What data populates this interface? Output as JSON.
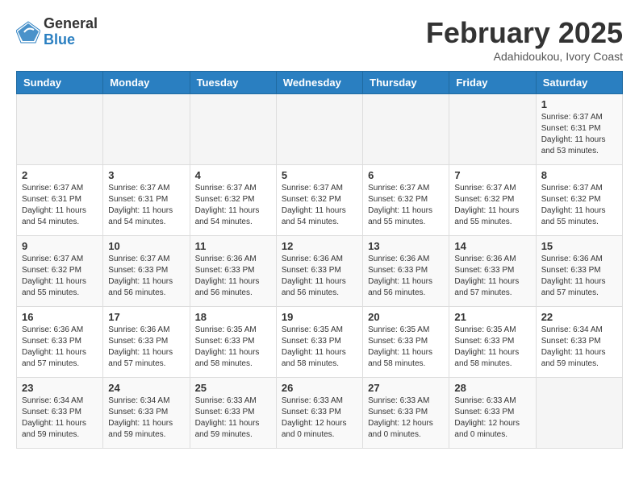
{
  "logo": {
    "general": "General",
    "blue": "Blue"
  },
  "header": {
    "month": "February 2025",
    "location": "Adahidoukou, Ivory Coast"
  },
  "days_of_week": [
    "Sunday",
    "Monday",
    "Tuesday",
    "Wednesday",
    "Thursday",
    "Friday",
    "Saturday"
  ],
  "weeks": [
    [
      {
        "day": "",
        "info": ""
      },
      {
        "day": "",
        "info": ""
      },
      {
        "day": "",
        "info": ""
      },
      {
        "day": "",
        "info": ""
      },
      {
        "day": "",
        "info": ""
      },
      {
        "day": "",
        "info": ""
      },
      {
        "day": "1",
        "info": "Sunrise: 6:37 AM\nSunset: 6:31 PM\nDaylight: 11 hours\nand 53 minutes."
      }
    ],
    [
      {
        "day": "2",
        "info": "Sunrise: 6:37 AM\nSunset: 6:31 PM\nDaylight: 11 hours\nand 54 minutes."
      },
      {
        "day": "3",
        "info": "Sunrise: 6:37 AM\nSunset: 6:31 PM\nDaylight: 11 hours\nand 54 minutes."
      },
      {
        "day": "4",
        "info": "Sunrise: 6:37 AM\nSunset: 6:32 PM\nDaylight: 11 hours\nand 54 minutes."
      },
      {
        "day": "5",
        "info": "Sunrise: 6:37 AM\nSunset: 6:32 PM\nDaylight: 11 hours\nand 54 minutes."
      },
      {
        "day": "6",
        "info": "Sunrise: 6:37 AM\nSunset: 6:32 PM\nDaylight: 11 hours\nand 55 minutes."
      },
      {
        "day": "7",
        "info": "Sunrise: 6:37 AM\nSunset: 6:32 PM\nDaylight: 11 hours\nand 55 minutes."
      },
      {
        "day": "8",
        "info": "Sunrise: 6:37 AM\nSunset: 6:32 PM\nDaylight: 11 hours\nand 55 minutes."
      }
    ],
    [
      {
        "day": "9",
        "info": "Sunrise: 6:37 AM\nSunset: 6:32 PM\nDaylight: 11 hours\nand 55 minutes."
      },
      {
        "day": "10",
        "info": "Sunrise: 6:37 AM\nSunset: 6:33 PM\nDaylight: 11 hours\nand 56 minutes."
      },
      {
        "day": "11",
        "info": "Sunrise: 6:36 AM\nSunset: 6:33 PM\nDaylight: 11 hours\nand 56 minutes."
      },
      {
        "day": "12",
        "info": "Sunrise: 6:36 AM\nSunset: 6:33 PM\nDaylight: 11 hours\nand 56 minutes."
      },
      {
        "day": "13",
        "info": "Sunrise: 6:36 AM\nSunset: 6:33 PM\nDaylight: 11 hours\nand 56 minutes."
      },
      {
        "day": "14",
        "info": "Sunrise: 6:36 AM\nSunset: 6:33 PM\nDaylight: 11 hours\nand 57 minutes."
      },
      {
        "day": "15",
        "info": "Sunrise: 6:36 AM\nSunset: 6:33 PM\nDaylight: 11 hours\nand 57 minutes."
      }
    ],
    [
      {
        "day": "16",
        "info": "Sunrise: 6:36 AM\nSunset: 6:33 PM\nDaylight: 11 hours\nand 57 minutes."
      },
      {
        "day": "17",
        "info": "Sunrise: 6:36 AM\nSunset: 6:33 PM\nDaylight: 11 hours\nand 57 minutes."
      },
      {
        "day": "18",
        "info": "Sunrise: 6:35 AM\nSunset: 6:33 PM\nDaylight: 11 hours\nand 58 minutes."
      },
      {
        "day": "19",
        "info": "Sunrise: 6:35 AM\nSunset: 6:33 PM\nDaylight: 11 hours\nand 58 minutes."
      },
      {
        "day": "20",
        "info": "Sunrise: 6:35 AM\nSunset: 6:33 PM\nDaylight: 11 hours\nand 58 minutes."
      },
      {
        "day": "21",
        "info": "Sunrise: 6:35 AM\nSunset: 6:33 PM\nDaylight: 11 hours\nand 58 minutes."
      },
      {
        "day": "22",
        "info": "Sunrise: 6:34 AM\nSunset: 6:33 PM\nDaylight: 11 hours\nand 59 minutes."
      }
    ],
    [
      {
        "day": "23",
        "info": "Sunrise: 6:34 AM\nSunset: 6:33 PM\nDaylight: 11 hours\nand 59 minutes."
      },
      {
        "day": "24",
        "info": "Sunrise: 6:34 AM\nSunset: 6:33 PM\nDaylight: 11 hours\nand 59 minutes."
      },
      {
        "day": "25",
        "info": "Sunrise: 6:33 AM\nSunset: 6:33 PM\nDaylight: 11 hours\nand 59 minutes."
      },
      {
        "day": "26",
        "info": "Sunrise: 6:33 AM\nSunset: 6:33 PM\nDaylight: 12 hours\nand 0 minutes."
      },
      {
        "day": "27",
        "info": "Sunrise: 6:33 AM\nSunset: 6:33 PM\nDaylight: 12 hours\nand 0 minutes."
      },
      {
        "day": "28",
        "info": "Sunrise: 6:33 AM\nSunset: 6:33 PM\nDaylight: 12 hours\nand 0 minutes."
      },
      {
        "day": "",
        "info": ""
      }
    ]
  ]
}
